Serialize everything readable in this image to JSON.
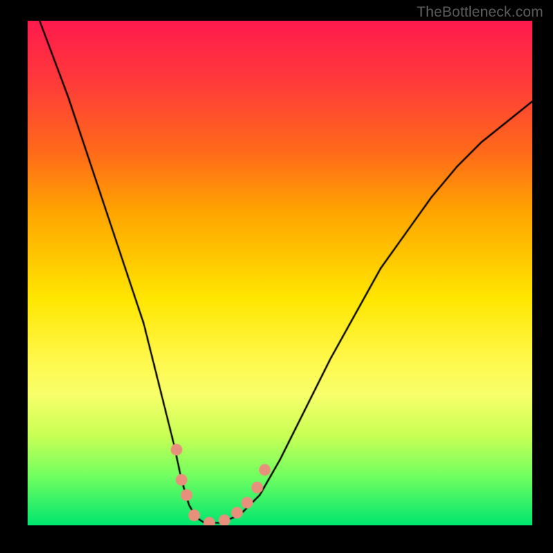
{
  "watermark": "TheBottleneck.com",
  "chart_data": {
    "type": "line",
    "title": "",
    "xlabel": "",
    "ylabel": "",
    "xlim": [
      0,
      100
    ],
    "ylim": [
      0,
      100
    ],
    "background": "vertical-gradient red-to-green",
    "series": [
      {
        "name": "bottleneck-curve",
        "style": "black-line",
        "x": [
          0,
          2,
          5,
          8,
          11,
          14,
          17,
          20,
          23,
          25,
          27,
          29,
          30.5,
          32,
          33.5,
          35,
          38,
          42,
          46,
          50,
          55,
          60,
          65,
          70,
          75,
          80,
          85,
          90,
          95,
          100
        ],
        "y": [
          107,
          101,
          93,
          85,
          76,
          67,
          58,
          49,
          40,
          32,
          24,
          16,
          9,
          4,
          1.5,
          0.5,
          0.5,
          2,
          6,
          13,
          23,
          33,
          42,
          51,
          58,
          65,
          71,
          76,
          80,
          84
        ]
      },
      {
        "name": "highlight-markers",
        "style": "salmon-dots",
        "points": [
          {
            "x": 29.5,
            "y": 15
          },
          {
            "x": 30.5,
            "y": 9
          },
          {
            "x": 31.5,
            "y": 6
          },
          {
            "x": 33.0,
            "y": 2
          },
          {
            "x": 36.0,
            "y": 0.5
          },
          {
            "x": 39.0,
            "y": 1
          },
          {
            "x": 41.5,
            "y": 2.5
          },
          {
            "x": 43.5,
            "y": 4.5
          },
          {
            "x": 45.5,
            "y": 7.5
          },
          {
            "x": 47.0,
            "y": 11
          }
        ]
      }
    ]
  }
}
